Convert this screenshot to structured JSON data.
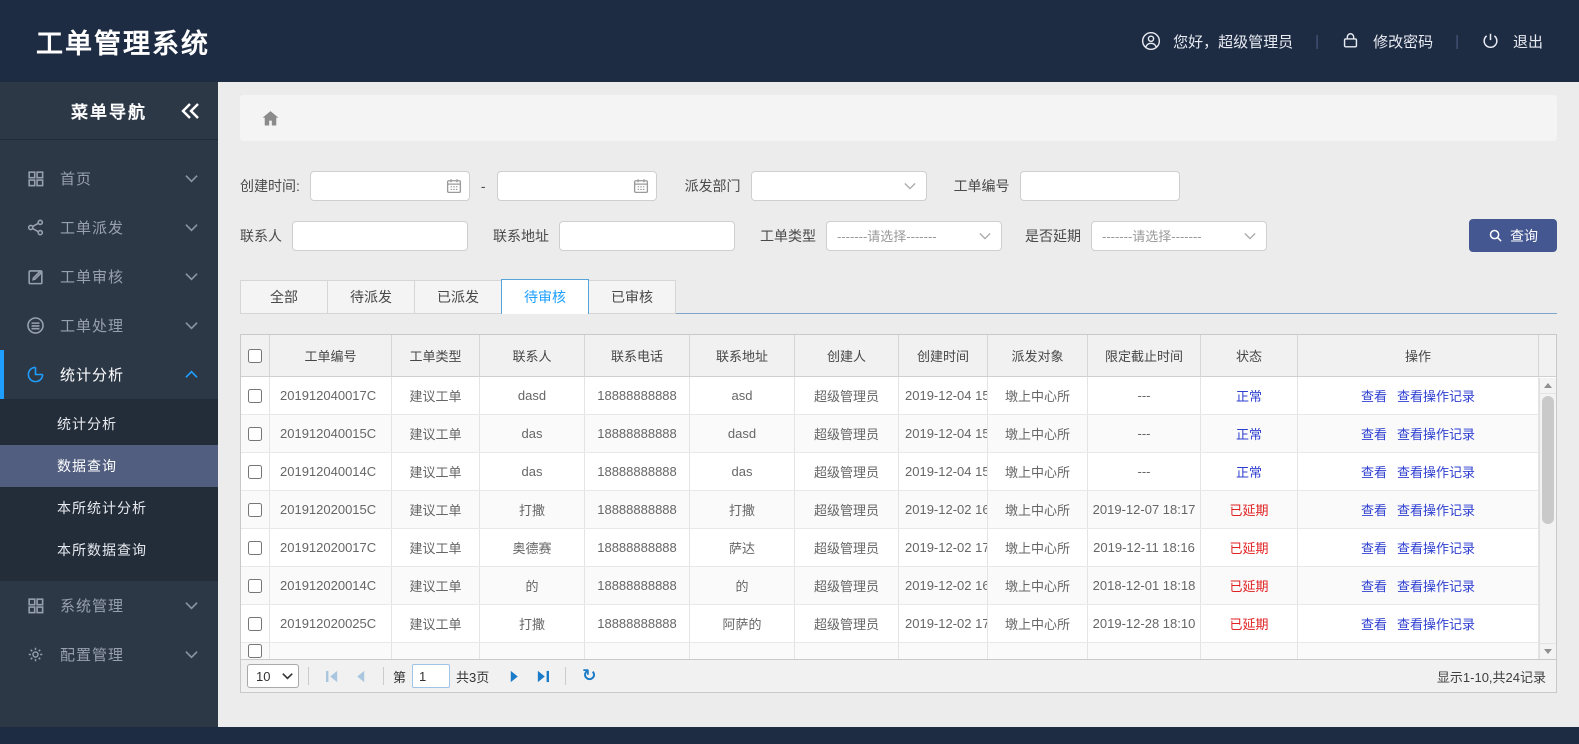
{
  "header": {
    "title": "工单管理系统",
    "greeting": "您好，超级管理员",
    "change_password": "修改密码",
    "logout": "退出"
  },
  "sidebar": {
    "title": "菜单导航",
    "items": [
      {
        "label": "首页"
      },
      {
        "label": "工单派发"
      },
      {
        "label": "工单审核"
      },
      {
        "label": "工单处理"
      },
      {
        "label": "统计分析",
        "active": true
      }
    ],
    "submenu": [
      {
        "label": "统计分析"
      },
      {
        "label": "数据查询",
        "active": true
      },
      {
        "label": "本所统计分析"
      },
      {
        "label": "本所数据查询"
      }
    ],
    "items_bottom": [
      {
        "label": "系统管理"
      },
      {
        "label": "配置管理"
      }
    ]
  },
  "filters": {
    "created_time_label": "创建时间:",
    "range_separator": "-",
    "dispatch_dept_label": "派发部门",
    "order_no_label": "工单编号",
    "contact_label": "联系人",
    "contact_address_label": "联系地址",
    "order_type_label": "工单类型",
    "order_type_value": "-------请选择-------",
    "is_delayed_label": "是否延期",
    "is_delayed_value": "-------请选择-------",
    "search_button": "查询"
  },
  "tabs": [
    {
      "label": "全部"
    },
    {
      "label": "待派发"
    },
    {
      "label": "已派发"
    },
    {
      "label": "待审核",
      "active": true
    },
    {
      "label": "已审核"
    }
  ],
  "table": {
    "columns": {
      "order_no": "工单编号",
      "order_type": "工单类型",
      "contact": "联系人",
      "phone": "联系电话",
      "address": "联系地址",
      "creator": "创建人",
      "created": "创建时间",
      "target": "派发对象",
      "deadline": "限定截止时间",
      "status": "状态",
      "ops": "操作"
    },
    "view_label": "查看",
    "view_log_label": "查看操作记录",
    "rows": [
      {
        "order_no": "201912040017C",
        "order_type": "建议工单",
        "contact": "dasd",
        "phone": "18888888888",
        "address": "asd",
        "creator": "超级管理员",
        "created": "2019-12-04 15",
        "target": "墩上中心所",
        "deadline": "---",
        "status": "正常"
      },
      {
        "order_no": "201912040015C",
        "order_type": "建议工单",
        "contact": "das",
        "phone": "18888888888",
        "address": "dasd",
        "creator": "超级管理员",
        "created": "2019-12-04 15",
        "target": "墩上中心所",
        "deadline": "---",
        "status": "正常"
      },
      {
        "order_no": "201912040014C",
        "order_type": "建议工单",
        "contact": "das",
        "phone": "18888888888",
        "address": "das",
        "creator": "超级管理员",
        "created": "2019-12-04 15",
        "target": "墩上中心所",
        "deadline": "---",
        "status": "正常"
      },
      {
        "order_no": "201912020015C",
        "order_type": "建议工单",
        "contact": "打撒",
        "phone": "18888888888",
        "address": "打撒",
        "creator": "超级管理员",
        "created": "2019-12-02 16",
        "target": "墩上中心所",
        "deadline": "2019-12-07 18:17",
        "status": "已延期"
      },
      {
        "order_no": "201912020017C",
        "order_type": "建议工单",
        "contact": "奥德赛",
        "phone": "18888888888",
        "address": "萨达",
        "creator": "超级管理员",
        "created": "2019-12-02 17",
        "target": "墩上中心所",
        "deadline": "2019-12-11 18:16",
        "status": "已延期"
      },
      {
        "order_no": "201912020014C",
        "order_type": "建议工单",
        "contact": "的",
        "phone": "18888888888",
        "address": "的",
        "creator": "超级管理员",
        "created": "2019-12-02 16",
        "target": "墩上中心所",
        "deadline": "2018-12-01 18:18",
        "status": "已延期"
      },
      {
        "order_no": "201912020025C",
        "order_type": "建议工单",
        "contact": "打撒",
        "phone": "18888888888",
        "address": "阿萨的",
        "creator": "超级管理员",
        "created": "2019-12-02 17",
        "target": "墩上中心所",
        "deadline": "2019-12-28 18:10",
        "status": "已延期"
      }
    ]
  },
  "pager": {
    "page_size": "10",
    "page_label": "第",
    "page_value": "1",
    "total_pages": "共3页",
    "refresh_icon": "↻",
    "summary": "显示1-10,共24记录"
  },
  "colors": {
    "topbar_bg": "#1d2b43",
    "sidebar_bg": "#2d3847",
    "sidebar_active_accent": "#1e9fff",
    "submenu_active_bg": "#515e80",
    "tab_active_text": "#1e9fff",
    "search_button_bg": "#445791",
    "link_blue": "#2e3fd0",
    "status_normal": "#2e3fd0",
    "status_delayed": "#e02222"
  }
}
